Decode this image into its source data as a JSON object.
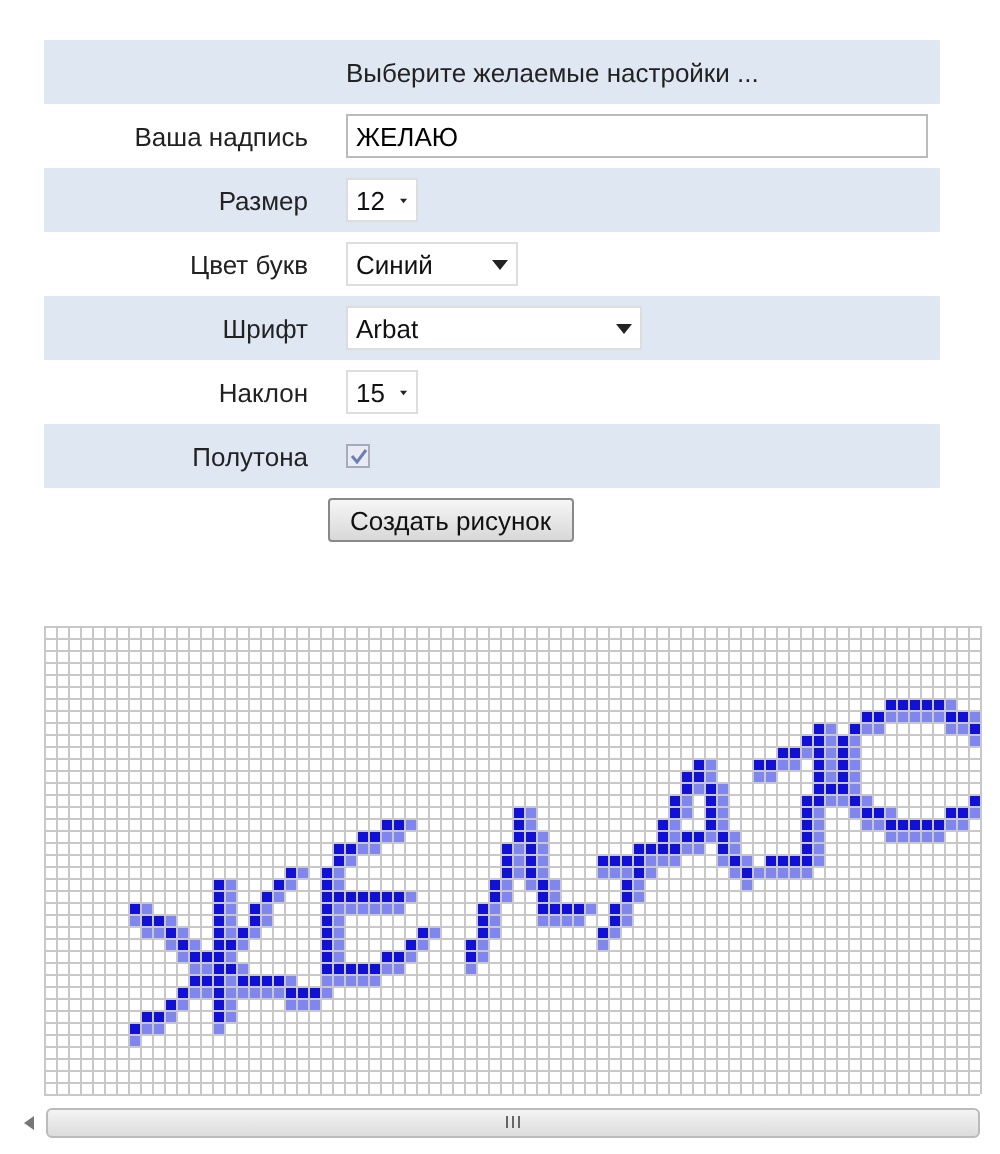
{
  "form": {
    "heading": "Выберите желаемые настройки ...",
    "fields": [
      {
        "kind": "text",
        "label": "Ваша надпись",
        "value": "ЖЕЛАЮ"
      },
      {
        "kind": "select",
        "label": "Размер",
        "value": "12"
      },
      {
        "kind": "select",
        "label": "Цвет букв",
        "value": "Синий"
      },
      {
        "kind": "select",
        "label": "Шрифт",
        "value": "Arbat"
      },
      {
        "kind": "select",
        "label": "Наклон",
        "value": "15"
      },
      {
        "kind": "checkbox",
        "label": "Полутона",
        "checked": true,
        "disabled": true
      }
    ],
    "submit": "Создать рисунок"
  }
}
